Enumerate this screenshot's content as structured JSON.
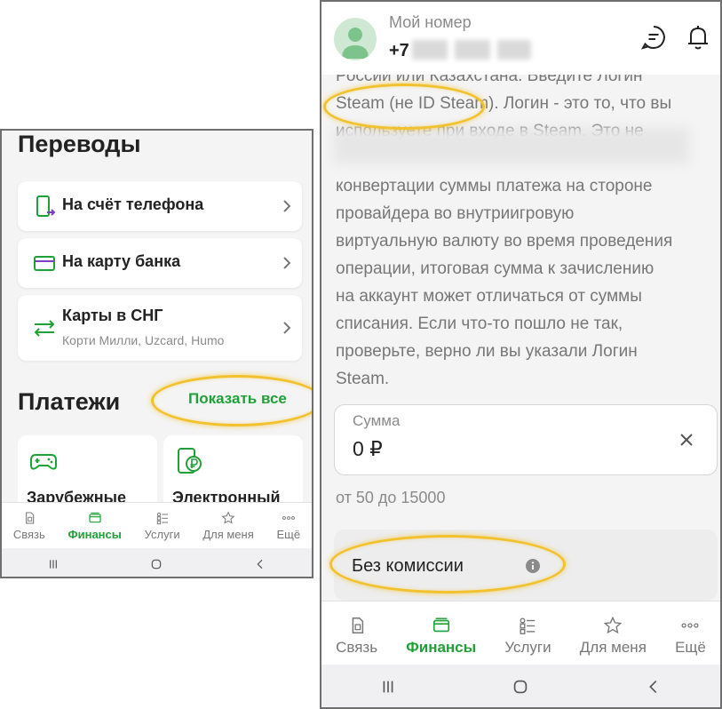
{
  "left": {
    "transfers": {
      "title": "Переводы",
      "items": [
        {
          "label": "На счёт телефона"
        },
        {
          "label": "На карту банка"
        },
        {
          "label": "Карты в СНГ",
          "sub": "Корти Милли, Uzcard, Humo"
        }
      ]
    },
    "payments": {
      "title": "Платежи",
      "show_all": "Показать все",
      "tiles": [
        {
          "label": "Зарубежные"
        },
        {
          "label": "Электронный"
        }
      ]
    }
  },
  "tabs": [
    {
      "label": "Связь",
      "icon": "sim-icon"
    },
    {
      "label": "Финансы",
      "icon": "wallet-icon",
      "active": true
    },
    {
      "label": "Услуги",
      "icon": "services-icon"
    },
    {
      "label": "Для меня",
      "icon": "star-icon"
    },
    {
      "label": "Ещё",
      "icon": "more-icon"
    }
  ],
  "right": {
    "header": {
      "title": "Мой номер",
      "phone_prefix": "+7"
    },
    "desc_lines": [
      "России или Казахстана. Введите Логин",
      "Steam (не ID Steam). Логин - это то, что вы",
      "используете при входе в Steam. Это не",
      "",
      "конвертации суммы платежа на стороне",
      "провайдера во внутриигровую",
      "виртуальную валюту во время проведения",
      "операции, итоговая сумма к зачислению",
      "на аккаунт может отличаться от суммы",
      "списания. Если что-то пошло не так,",
      "проверьте, верно ли вы указали Логин",
      "Steam."
    ],
    "amount": {
      "label": "Сумма",
      "value": "0 ₽"
    },
    "range": "от 50 до 15000",
    "fee": "Без комиссии"
  },
  "colors": {
    "accent": "#21a038",
    "highlight": "#f2c12e"
  }
}
